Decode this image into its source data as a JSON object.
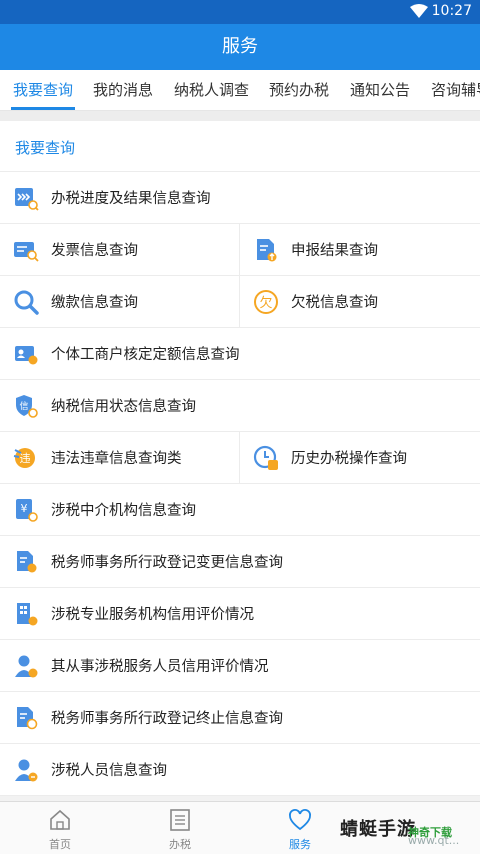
{
  "status_bar": {
    "time": "10:27"
  },
  "header": {
    "title": "服务"
  },
  "tabs": [
    {
      "label": "我要查询",
      "active": true
    },
    {
      "label": "我的消息"
    },
    {
      "label": "纳税人调查"
    },
    {
      "label": "预约办税"
    },
    {
      "label": "通知公告"
    },
    {
      "label": "咨询辅导"
    }
  ],
  "section": {
    "title": "我要查询"
  },
  "rows": [
    [
      "办税进度及结果信息查询"
    ],
    [
      "发票信息查询",
      "申报结果查询"
    ],
    [
      "缴款信息查询",
      "欠税信息查询"
    ],
    [
      "个体工商户核定定额信息查询"
    ],
    [
      "纳税信用状态信息查询"
    ],
    [
      "违法违章信息查询类",
      "历史办税操作查询"
    ],
    [
      "涉税中介机构信息查询"
    ],
    [
      "税务师事务所行政登记变更信息查询"
    ],
    [
      "涉税专业服务机构信用评价情况"
    ],
    [
      "其从事涉税服务人员信用评价情况"
    ],
    [
      "税务师事务所行政登记终止信息查询"
    ],
    [
      "涉税人员信息查询"
    ]
  ],
  "icons": {
    "row0": "progress-search-icon",
    "row1a": "invoice-search-icon",
    "row1b": "declaration-result-icon",
    "row2a": "magnifier-icon",
    "row2b": "arrears-icon",
    "row3": "business-id-icon",
    "row4": "credit-shield-icon",
    "row5a": "violation-icon",
    "row5b": "history-clock-icon",
    "row6": "agency-yuan-icon",
    "row7": "firm-change-icon",
    "row8": "building-rating-icon",
    "row9": "person-rating-icon",
    "row10": "firm-terminate-icon",
    "row11": "person-info-icon"
  },
  "bottom_nav": [
    {
      "label": "首页",
      "icon": "home-icon"
    },
    {
      "label": "办税",
      "icon": "list-icon"
    },
    {
      "label": "服务",
      "icon": "heart-icon",
      "active": true
    },
    {
      "label": "",
      "icon": ""
    }
  ],
  "watermark": {
    "brand": "蜻蜓手游",
    "tag": "神奇下载",
    "url": "www.qt..."
  },
  "colors": {
    "primary": "#1e88e5",
    "status_bar": "#1565c0",
    "icon_blue": "#4a90e2",
    "icon_orange": "#f5a623"
  }
}
